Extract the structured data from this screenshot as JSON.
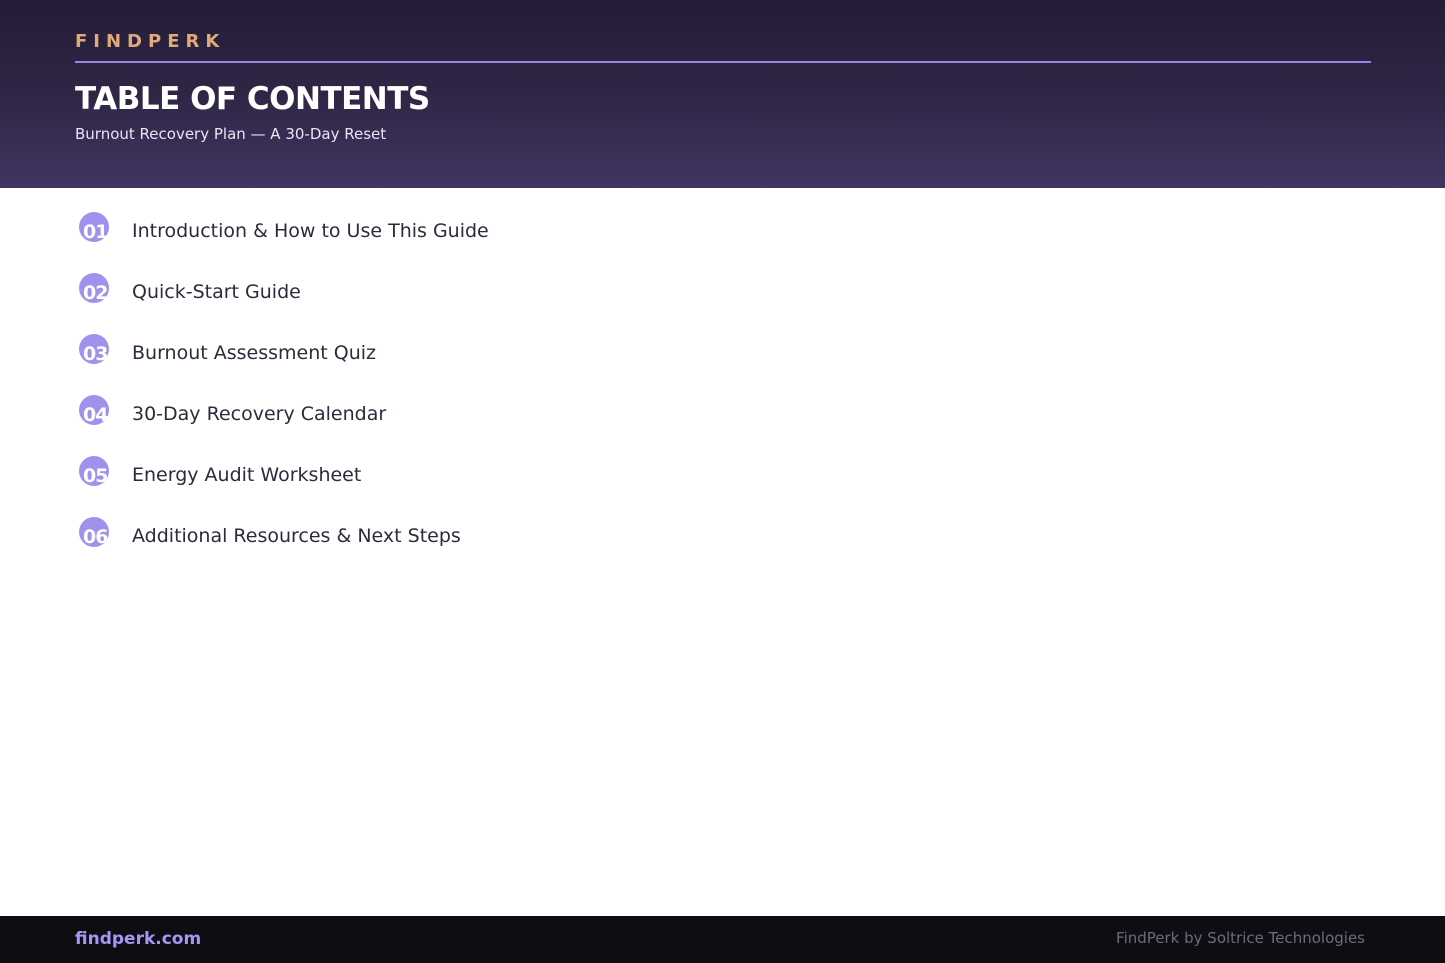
{
  "header": {
    "brand": "FINDPERK",
    "title": "TABLE OF CONTENTS",
    "subtitle": "Burnout Recovery Plan — A 30-Day Reset"
  },
  "toc": {
    "items": [
      {
        "number": "01",
        "label": "Introduction & How to Use This Guide"
      },
      {
        "number": "02",
        "label": "Quick-Start Guide"
      },
      {
        "number": "03",
        "label": "Burnout Assessment Quiz"
      },
      {
        "number": "04",
        "label": "30-Day Recovery Calendar"
      },
      {
        "number": "05",
        "label": "Energy Audit Worksheet"
      },
      {
        "number": "06",
        "label": "Additional Resources & Next Steps"
      }
    ]
  },
  "footer": {
    "link": "findperk.com",
    "credit": "FindPerk by Soltrice Technologies"
  },
  "colors": {
    "brand_accent": "#e0aa78",
    "rule": "#9686e6",
    "badge": "#9e92ec",
    "link": "#a597f5"
  }
}
